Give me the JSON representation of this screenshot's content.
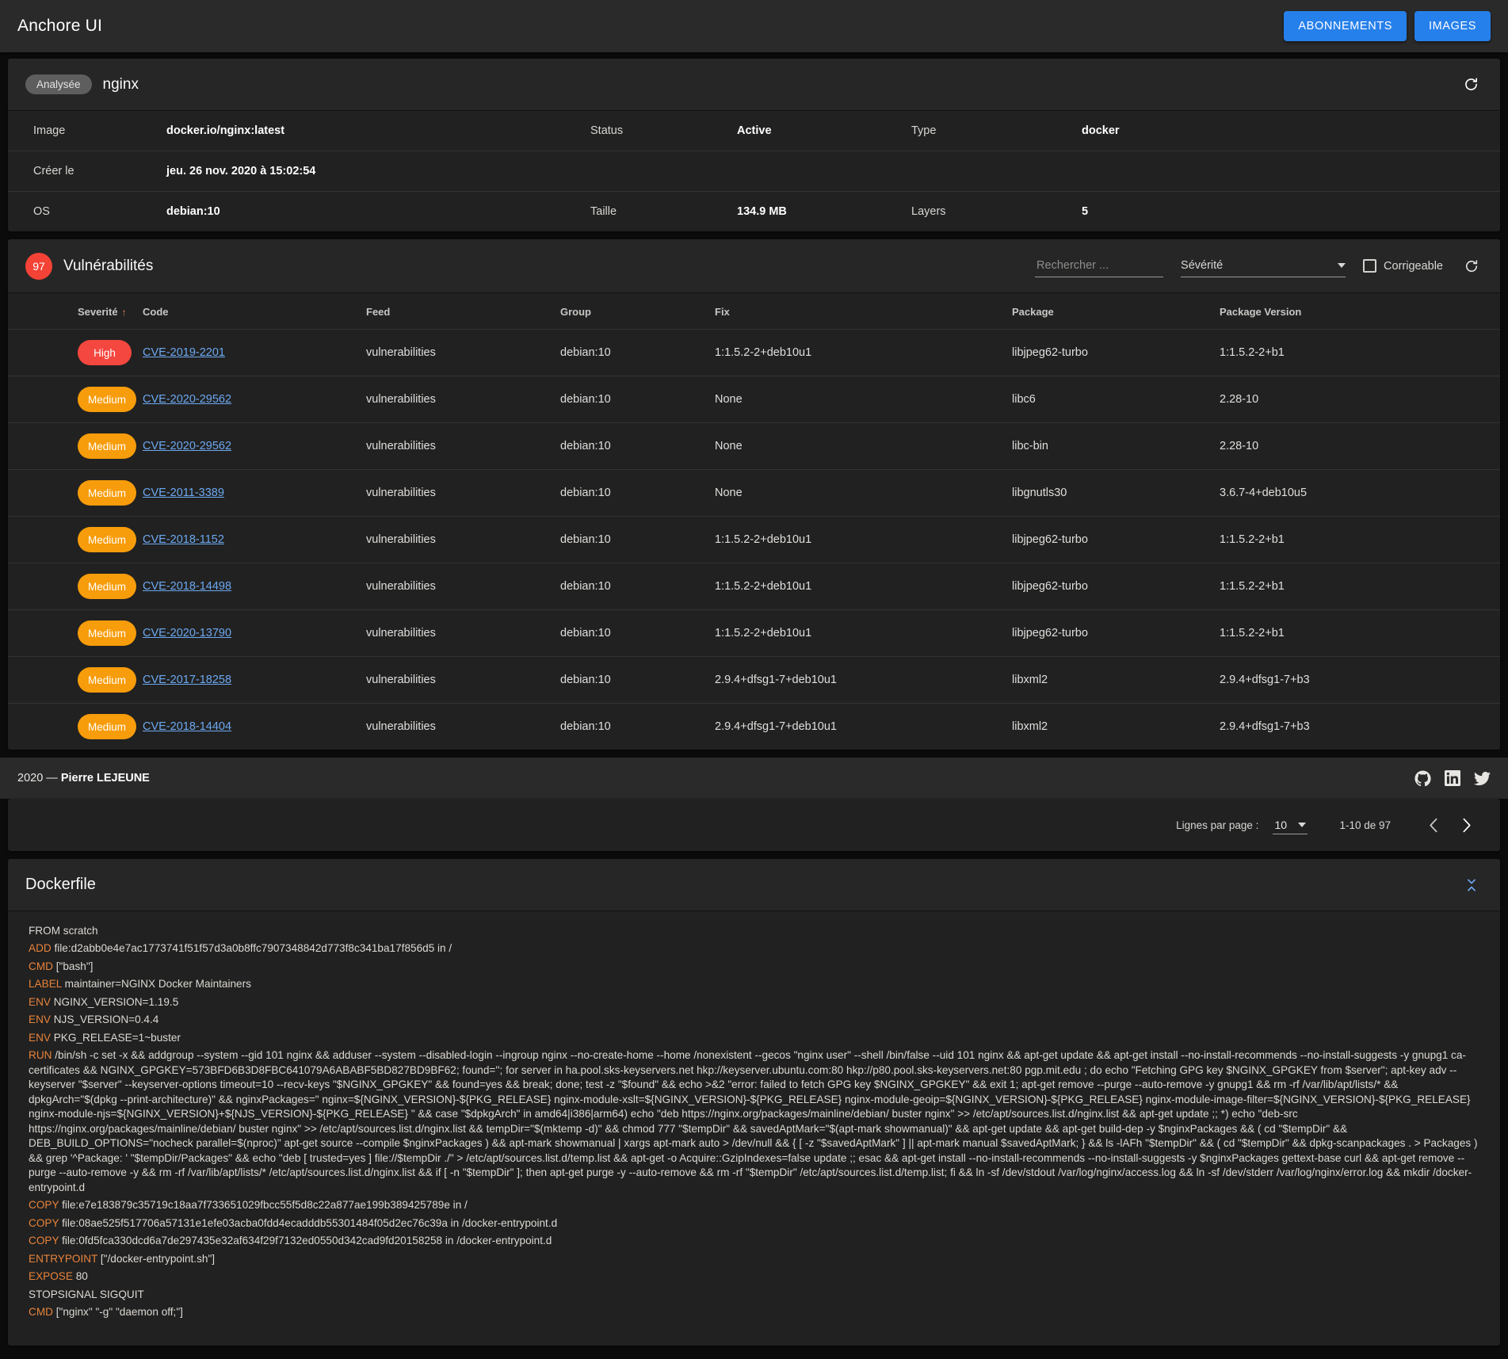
{
  "appbar": {
    "title": "Anchore UI",
    "buttons": [
      {
        "label": "ABONNEMENTS",
        "name": "subscriptions-button"
      },
      {
        "label": "IMAGES",
        "name": "images-button"
      }
    ]
  },
  "image_card": {
    "status_chip": "Analysée",
    "name": "nginx",
    "refresh_icon": "refresh-icon",
    "rows": [
      {
        "l1": "Image",
        "v1": "docker.io/nginx:latest",
        "l2": "Status",
        "v2": "Active",
        "l3": "Type",
        "v3": "docker"
      },
      {
        "l1": "Créer le",
        "v1": "jeu. 26 nov. 2020 à 15:02:54",
        "l2": "",
        "v2": "",
        "l3": "",
        "v3": ""
      },
      {
        "l1": "OS",
        "v1": "debian:10",
        "l2": "Taille",
        "v2": "134.9 MB",
        "l3": "Layers",
        "v3": "5"
      }
    ]
  },
  "vulnerabilities": {
    "count": "97",
    "title": "Vulnérabilités",
    "search_placeholder": "Rechercher ...",
    "severity_label": "Sévérité",
    "fixable_label": "Corrigeable",
    "refresh_icon": "refresh-icon",
    "columns": [
      "Severité",
      "Code",
      "Feed",
      "Group",
      "Fix",
      "Package",
      "Package Version"
    ],
    "sort_indicator": "↑",
    "rows": [
      {
        "severity": "High",
        "code": "CVE-2019-2201",
        "feed": "vulnerabilities",
        "group": "debian:10",
        "fix": "1:1.5.2-2+deb10u1",
        "package": "libjpeg62-turbo",
        "package_version": "1:1.5.2-2+b1"
      },
      {
        "severity": "Medium",
        "code": "CVE-2020-29562",
        "feed": "vulnerabilities",
        "group": "debian:10",
        "fix": "None",
        "package": "libc6",
        "package_version": "2.28-10"
      },
      {
        "severity": "Medium",
        "code": "CVE-2020-29562",
        "feed": "vulnerabilities",
        "group": "debian:10",
        "fix": "None",
        "package": "libc-bin",
        "package_version": "2.28-10"
      },
      {
        "severity": "Medium",
        "code": "CVE-2011-3389",
        "feed": "vulnerabilities",
        "group": "debian:10",
        "fix": "None",
        "package": "libgnutls30",
        "package_version": "3.6.7-4+deb10u5"
      },
      {
        "severity": "Medium",
        "code": "CVE-2018-1152",
        "feed": "vulnerabilities",
        "group": "debian:10",
        "fix": "1:1.5.2-2+deb10u1",
        "package": "libjpeg62-turbo",
        "package_version": "1:1.5.2-2+b1"
      },
      {
        "severity": "Medium",
        "code": "CVE-2018-14498",
        "feed": "vulnerabilities",
        "group": "debian:10",
        "fix": "1:1.5.2-2+deb10u1",
        "package": "libjpeg62-turbo",
        "package_version": "1:1.5.2-2+b1"
      },
      {
        "severity": "Medium",
        "code": "CVE-2020-13790",
        "feed": "vulnerabilities",
        "group": "debian:10",
        "fix": "1:1.5.2-2+deb10u1",
        "package": "libjpeg62-turbo",
        "package_version": "1:1.5.2-2+b1"
      },
      {
        "severity": "Medium",
        "code": "CVE-2017-18258",
        "feed": "vulnerabilities",
        "group": "debian:10",
        "fix": "2.9.4+dfsg1-7+deb10u1",
        "package": "libxml2",
        "package_version": "2.9.4+dfsg1-7+b3"
      },
      {
        "severity": "Medium",
        "code": "CVE-2018-14404",
        "feed": "vulnerabilities",
        "group": "debian:10",
        "fix": "2.9.4+dfsg1-7+deb10u1",
        "package": "libxml2",
        "package_version": "2.9.4+dfsg1-7+b3"
      }
    ],
    "severity_colors": {
      "High": "#f4473f",
      "Medium": "#f79c0a"
    }
  },
  "footer": {
    "year_author_prefix": "2020 — ",
    "author": "Pierre LEJEUNE",
    "social": [
      {
        "name": "github-icon"
      },
      {
        "name": "linkedin-icon"
      },
      {
        "name": "twitter-icon"
      }
    ]
  },
  "paginator": {
    "rows_per_page_label": "Lignes par page :",
    "rows_per_page_value": "10",
    "range_label": "1-10 de 97",
    "prev_icon": "chevron-left-icon",
    "next_icon": "chevron-right-icon"
  },
  "dockerfile": {
    "title": "Dockerfile",
    "collapse_icon": "collapse-icon",
    "lines": [
      {
        "kw": "",
        "text": "FROM scratch"
      },
      {
        "kw": "ADD",
        "text": "file:d2abb0e4e7ac1773741f51f57d3a0b8ffc7907348842d773f8c341ba17f856d5 in /"
      },
      {
        "kw": "CMD",
        "text": "[\"bash\"]"
      },
      {
        "kw": "LABEL",
        "text": "maintainer=NGINX Docker Maintainers"
      },
      {
        "kw": "ENV",
        "text": "NGINX_VERSION=1.19.5"
      },
      {
        "kw": "ENV",
        "text": "NJS_VERSION=0.4.4"
      },
      {
        "kw": "ENV",
        "text": "PKG_RELEASE=1~buster"
      },
      {
        "kw": "RUN",
        "text": "/bin/sh -c set -x && addgroup --system --gid 101 nginx && adduser --system --disabled-login --ingroup nginx --no-create-home --home /nonexistent --gecos \"nginx user\" --shell /bin/false --uid 101 nginx && apt-get update && apt-get install --no-install-recommends --no-install-suggests -y gnupg1 ca-certificates && NGINX_GPGKEY=573BFD6B3D8FBC641079A6ABABF5BD827BD9BF62; found=''; for server in ha.pool.sks-keyservers.net hkp://keyserver.ubuntu.com:80 hkp://p80.pool.sks-keyservers.net:80 pgp.mit.edu ; do echo \"Fetching GPG key $NGINX_GPGKEY from $server\"; apt-key adv --keyserver \"$server\" --keyserver-options timeout=10 --recv-keys \"$NGINX_GPGKEY\" && found=yes && break; done; test -z \"$found\" && echo >&2 \"error: failed to fetch GPG key $NGINX_GPGKEY\" && exit 1; apt-get remove --purge --auto-remove -y gnupg1 && rm -rf /var/lib/apt/lists/* && dpkgArch=\"$(dpkg --print-architecture)\" && nginxPackages=\" nginx=${NGINX_VERSION}-${PKG_RELEASE} nginx-module-xslt=${NGINX_VERSION}-${PKG_RELEASE} nginx-module-geoip=${NGINX_VERSION}-${PKG_RELEASE} nginx-module-image-filter=${NGINX_VERSION}-${PKG_RELEASE} nginx-module-njs=${NGINX_VERSION}+${NJS_VERSION}-${PKG_RELEASE} \" && case \"$dpkgArch\" in amd64|i386|arm64) echo \"deb https://nginx.org/packages/mainline/debian/ buster nginx\" >> /etc/apt/sources.list.d/nginx.list && apt-get update ;; *) echo \"deb-src https://nginx.org/packages/mainline/debian/ buster nginx\" >> /etc/apt/sources.list.d/nginx.list && tempDir=\"$(mktemp -d)\" && chmod 777 \"$tempDir\" && savedAptMark=\"$(apt-mark showmanual)\" && apt-get update && apt-get build-dep -y $nginxPackages && ( cd \"$tempDir\" && DEB_BUILD_OPTIONS=\"nocheck parallel=$(nproc)\" apt-get source --compile $nginxPackages ) && apt-mark showmanual | xargs apt-mark auto > /dev/null && { [ -z \"$savedAptMark\" ] || apt-mark manual $savedAptMark; } && ls -lAFh \"$tempDir\" && ( cd \"$tempDir\" && dpkg-scanpackages . > Packages ) && grep '^Package: ' \"$tempDir/Packages\" && echo \"deb [ trusted=yes ] file://$tempDir ./\" > /etc/apt/sources.list.d/temp.list && apt-get -o Acquire::GzipIndexes=false update ;; esac && apt-get install --no-install-recommends --no-install-suggests -y $nginxPackages gettext-base curl && apt-get remove --purge --auto-remove -y && rm -rf /var/lib/apt/lists/* /etc/apt/sources.list.d/nginx.list && if [ -n \"$tempDir\" ]; then apt-get purge -y --auto-remove && rm -rf \"$tempDir\" /etc/apt/sources.list.d/temp.list; fi && ln -sf /dev/stdout /var/log/nginx/access.log && ln -sf /dev/stderr /var/log/nginx/error.log && mkdir /docker-entrypoint.d"
      },
      {
        "kw": "COPY",
        "text": "file:e7e183879c35719c18aa7f733651029fbcc55f5d8c22a877ae199b389425789e in /"
      },
      {
        "kw": "COPY",
        "text": "file:08ae525f517706a57131e1efe03acba0fdd4ecadddb55301484f05d2ec76c39a in /docker-entrypoint.d"
      },
      {
        "kw": "COPY",
        "text": "file:0fd5fca330dcd6a7de297435e32af634f29f7132ed0550d342cad9fd20158258 in /docker-entrypoint.d"
      },
      {
        "kw": "ENTRYPOINT",
        "text": "[\"/docker-entrypoint.sh\"]"
      },
      {
        "kw": "EXPOSE",
        "text": "80"
      },
      {
        "kw": "",
        "text": "STOPSIGNAL SIGQUIT"
      },
      {
        "kw": "CMD",
        "text": "[\"nginx\" \"-g\" \"daemon off;\"]"
      }
    ]
  }
}
